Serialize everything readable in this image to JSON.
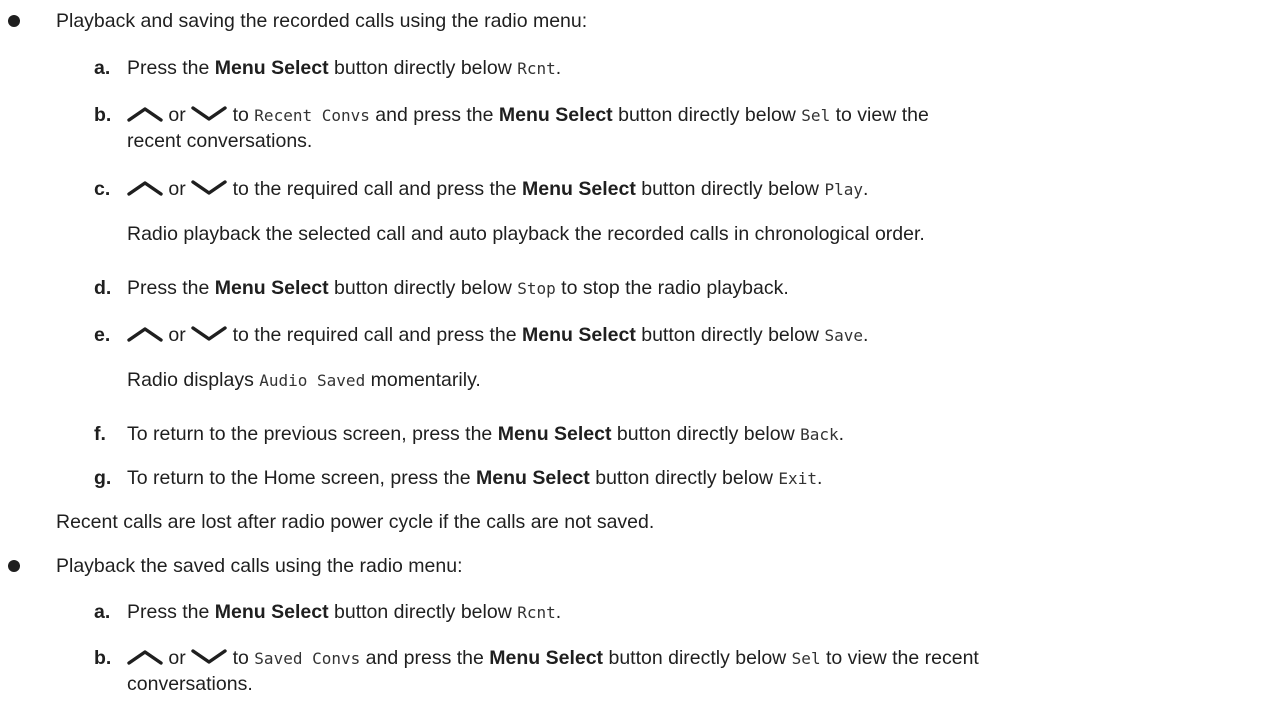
{
  "sections": [
    {
      "heading": "Playback and saving the recorded calls using the radio menu:",
      "steps": {
        "a": {
          "label": "a.",
          "t1": "Press the ",
          "b1": "Menu Select",
          "t2": " button directly below ",
          "m1": "Rcnt",
          "t3": "."
        },
        "b": {
          "label": "b.",
          "or": " or ",
          "to": " to ",
          "m1": "Recent Convs",
          "t1": " and press the ",
          "b1": "Menu Select",
          "t2": " button directly below ",
          "m2": "Sel",
          "t3": " to view the",
          "cont": "recent conversations."
        },
        "c": {
          "label": "c.",
          "or": " or ",
          "t1": " to the required call and press the ",
          "b1": "Menu Select",
          "t2": " button directly below ",
          "m1": "Play",
          "t3": ".",
          "note": "Radio playback the selected call and auto playback the recorded calls in chronological order."
        },
        "d": {
          "label": "d.",
          "t1": "Press the ",
          "b1": "Menu Select",
          "t2": " button directly below ",
          "m1": "Stop",
          "t3": " to stop the radio playback."
        },
        "e": {
          "label": "e.",
          "or": " or ",
          "t1": " to the required call and press the ",
          "b1": "Menu Select",
          "t2": " button directly below ",
          "m1": "Save",
          "t3": ".",
          "note_pre": "Radio displays ",
          "note_mono": "Audio Saved",
          "note_post": " momentarily."
        },
        "f": {
          "label": "f.",
          "t1": "To return to the previous screen, press the ",
          "b1": "Menu Select",
          "t2": " button directly below ",
          "m1": "Back",
          "t3": "."
        },
        "g": {
          "label": "g.",
          "t1": "To return to the Home screen, press the ",
          "b1": "Menu Select",
          "t2": " button directly below ",
          "m1": "Exit",
          "t3": "."
        }
      },
      "footer": "Recent calls are lost after radio power cycle if the calls are not saved."
    },
    {
      "heading": "Playback the saved calls using the radio menu:",
      "steps": {
        "a": {
          "label": "a.",
          "t1": "Press the ",
          "b1": "Menu Select",
          "t2": " button directly below ",
          "m1": "Rcnt",
          "t3": "."
        },
        "b": {
          "label": "b.",
          "or": " or ",
          "to": " to ",
          "m1": "Saved Convs",
          "t1": " and press the ",
          "b1": "Menu Select",
          "t2": " button directly below ",
          "m2": "Sel",
          "t3": " to view the recent",
          "cont": "conversations."
        }
      }
    }
  ],
  "icons": {
    "up": "chevron-up-icon",
    "down": "chevron-down-icon"
  }
}
